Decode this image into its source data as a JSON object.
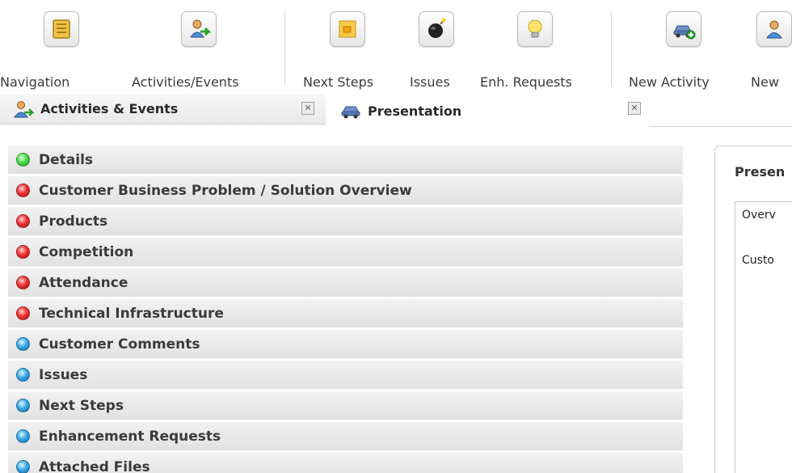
{
  "toolbar": {
    "buttons": [
      {
        "label": "Navigation",
        "icon": "folder-icon"
      },
      {
        "label": "Activities/Events",
        "icon": "user-arrow-icon"
      },
      {
        "label": "Next Steps",
        "icon": "sticky-note-icon"
      },
      {
        "label": "Issues",
        "icon": "bomb-icon"
      },
      {
        "label": "Enh. Requests",
        "icon": "lightbulb-icon"
      },
      {
        "label": "New Activity",
        "icon": "car-add-icon"
      },
      {
        "label": "New",
        "icon": "user-icon"
      }
    ]
  },
  "tabs": [
    {
      "label": "Activities & Events",
      "icon": "user-arrow-icon",
      "close": "✕"
    },
    {
      "label": "Presentation",
      "icon": "car-icon",
      "close": "✕"
    }
  ],
  "sections": [
    {
      "label": "Details",
      "status": "green"
    },
    {
      "label": "Customer Business Problem / Solution Overview",
      "status": "red"
    },
    {
      "label": "Products",
      "status": "red"
    },
    {
      "label": "Competition",
      "status": "red"
    },
    {
      "label": "Attendance",
      "status": "red"
    },
    {
      "label": "Technical Infrastructure",
      "status": "red"
    },
    {
      "label": "Customer Comments",
      "status": "blue"
    },
    {
      "label": "Issues",
      "status": "blue"
    },
    {
      "label": "Next Steps",
      "status": "blue"
    },
    {
      "label": "Enhancement Requests",
      "status": "blue"
    },
    {
      "label": "Attached Files",
      "status": "blue"
    }
  ],
  "panel": {
    "title": "Presen",
    "lines": [
      "Overv",
      "Custo"
    ]
  },
  "colors": {
    "status_green": "#3cc83a",
    "status_red": "#e02a2a",
    "status_blue": "#2a9bdc"
  }
}
